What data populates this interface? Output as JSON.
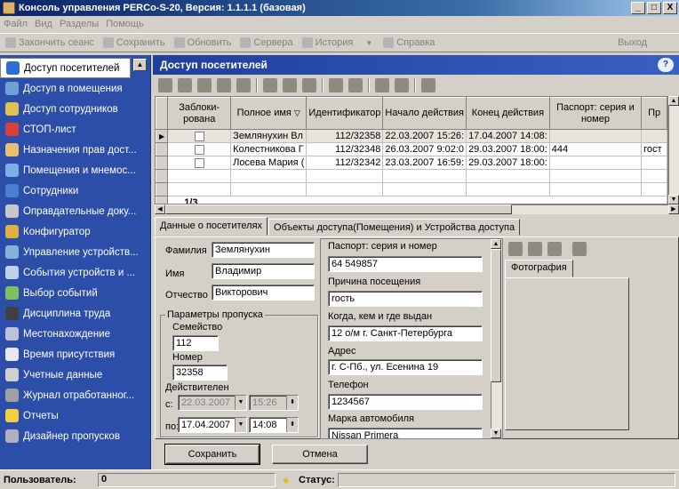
{
  "window": {
    "title": "Консоль управления PERCo-S-20, Версия: 1.1.1.1 (базовая)",
    "minimize": "_",
    "maximize": "□",
    "close": "X"
  },
  "menu": [
    "Файл",
    "Вид",
    "Разделы",
    "Помощь"
  ],
  "toolbar": {
    "end_session": "Закончить сеанс",
    "save": "Сохранить",
    "refresh": "Обновить",
    "servers": "Сервера",
    "history": "История",
    "help": "Справка",
    "exit": "Выход"
  },
  "nav": {
    "items": [
      {
        "label": "Доступ посетителей",
        "icon": "visitors-icon",
        "color": "#2b6fd6"
      },
      {
        "label": "Доступ в помещения",
        "icon": "rooms-access-icon",
        "color": "#6fa0d8"
      },
      {
        "label": "Доступ сотрудников",
        "icon": "lock-icon",
        "color": "#e0c050"
      },
      {
        "label": "СТОП-лист",
        "icon": "stop-icon",
        "color": "#d8403a"
      },
      {
        "label": "Назначения прав дост...",
        "icon": "rights-icon",
        "color": "#e8c070"
      },
      {
        "label": "Помещения и мнемос...",
        "icon": "building-icon",
        "color": "#7db0e8"
      },
      {
        "label": "Сотрудники",
        "icon": "employees-icon",
        "color": "#4a80d0"
      },
      {
        "label": "Оправдательные доку...",
        "icon": "documents-icon",
        "color": "#c8c8c8"
      },
      {
        "label": "Конфигуратор",
        "icon": "key-icon",
        "color": "#e0b040"
      },
      {
        "label": "Управление устройств...",
        "icon": "devices-icon",
        "color": "#88b0d8"
      },
      {
        "label": "События устройств и ...",
        "icon": "events-icon",
        "color": "#c0d0e8"
      },
      {
        "label": "Выбор событий",
        "icon": "filter-icon",
        "color": "#80c060"
      },
      {
        "label": "Дисциплина труда",
        "icon": "discipline-icon",
        "color": "#404040"
      },
      {
        "label": "Местонахождение",
        "icon": "location-icon",
        "color": "#c0c0d8"
      },
      {
        "label": "Время присутствия",
        "icon": "clock-icon",
        "color": "#e8e8f0"
      },
      {
        "label": "Учетные данные",
        "icon": "records-icon",
        "color": "#d0d0d0"
      },
      {
        "label": "Журнал отработанног...",
        "icon": "journal-icon",
        "color": "#a0a0a0"
      },
      {
        "label": "Отчеты",
        "icon": "reports-icon",
        "color": "#f0d040"
      },
      {
        "label": "Дизайнер пропусков",
        "icon": "pass-designer-icon",
        "color": "#b0b0c0"
      }
    ],
    "scroll_up": "▲"
  },
  "panel": {
    "title": "Доступ посетителей",
    "help": "?"
  },
  "grid": {
    "columns": [
      "Заблоки-рована",
      "Полное имя",
      "Идентификатор",
      "Начало действия",
      "Конец действия",
      "Паспорт: серия и номер",
      "Пр"
    ],
    "rows": [
      {
        "name": "Землянухин Вл",
        "id": "112/32358",
        "start": "22.03.2007 15:26:",
        "end": "17.04.2007 14:08:",
        "passport": "",
        "purpose": ""
      },
      {
        "name": "Колестникова Г",
        "id": "112/32348",
        "start": "26.03.2007 9:02:0",
        "end": "29.03.2007 18:00:",
        "passport": "444",
        "purpose": "гост"
      },
      {
        "name": "Лосева Мария (",
        "id": "112/32342",
        "start": "23.03.2007 16:59:",
        "end": "29.03.2007 18:00:",
        "passport": "",
        "purpose": ""
      }
    ],
    "counter": "1/3",
    "row_indicator": "▶",
    "sort_marker": "▽"
  },
  "tabs": [
    "Данные о посетителях",
    "Объекты доступа(Помещения) и Устройства доступа"
  ],
  "visitor": {
    "lastname_label": "Фамилия",
    "lastname": "Землянухин",
    "firstname_label": "Имя",
    "firstname": "Владимир",
    "patronymic_label": "Отчество",
    "patronymic": "Викторович",
    "pass_group": "Параметры пропуска",
    "family_label": "Семейство",
    "family": "112",
    "number_label": "Номер",
    "number": "32358",
    "valid_label": "Действителен",
    "from_label": "с:",
    "from_date": "22.03.2007",
    "from_time": "15:26",
    "to_label": "по:",
    "to_date": "17.04.2007",
    "to_time": "14:08"
  },
  "details": {
    "passport_label": "Паспорт: серия и номер",
    "passport": "64 549857",
    "reason_label": "Причина посещения",
    "reason": "гость",
    "issued_label": "Когда, кем и где выдан",
    "issued": "12 о/м г. Санкт-Петербурга",
    "address_label": "Адрес",
    "address": "г. С-Пб., ул. Есенина 19",
    "phone_label": "Телефон",
    "phone": "1234567",
    "car_label": "Марка автомобиля",
    "car": "Nissan Primera"
  },
  "photo": {
    "tab": "Фотография"
  },
  "buttons": {
    "save": "Сохранить",
    "cancel": "Отмена"
  },
  "status": {
    "user_label": "Пользователь:",
    "user_value": "0",
    "status_label": "Статус:"
  }
}
